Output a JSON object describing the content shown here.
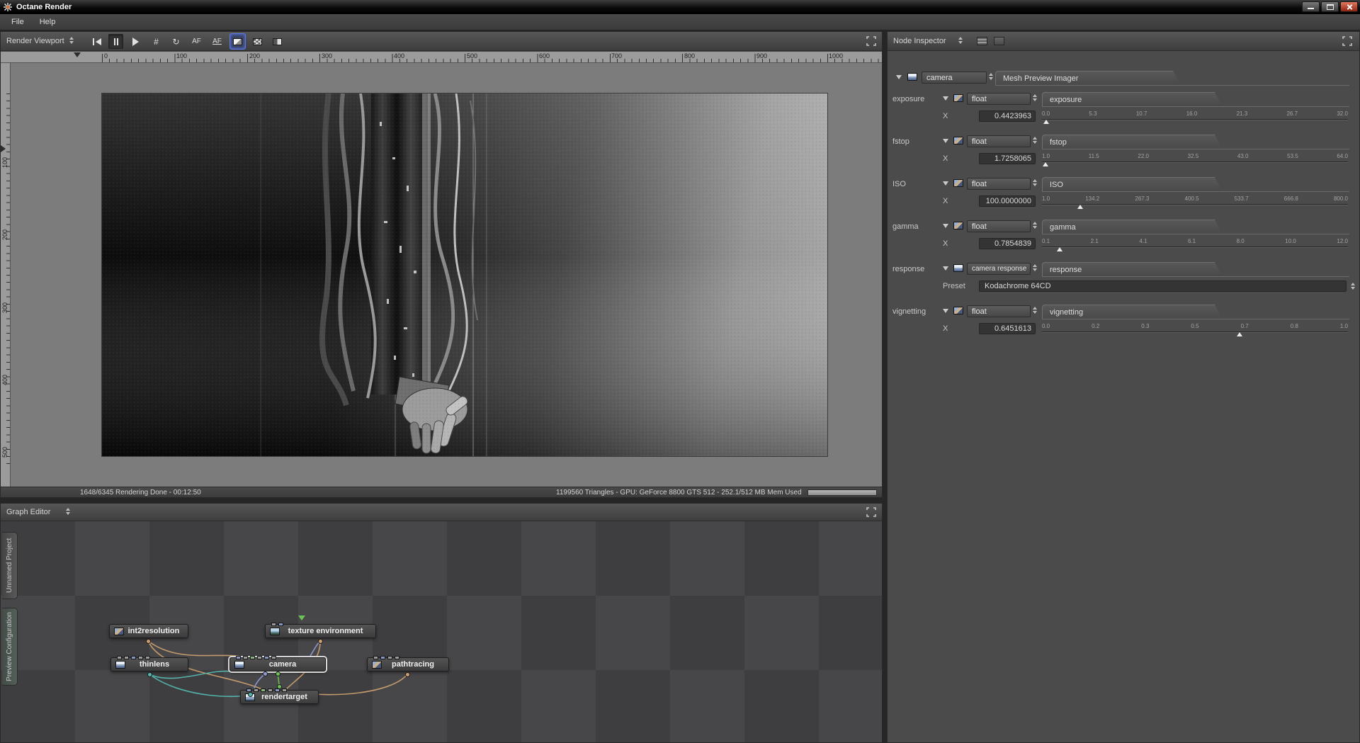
{
  "window": {
    "title": "Octane Render"
  },
  "menubar": {
    "file": "File",
    "help": "Help"
  },
  "render_viewport": {
    "title": "Render Viewport",
    "toolbar": {
      "grid": "#",
      "refresh": "↻",
      "af1": "AF",
      "af2": "AF"
    },
    "ruler_h": [
      "0",
      "100",
      "200",
      "300",
      "400",
      "500",
      "600",
      "700",
      "800",
      "900",
      "1000"
    ],
    "ruler_v": [
      "100",
      "200",
      "300",
      "400",
      "500"
    ],
    "status_left": "1648/6345 Rendering Done - 00:12:50",
    "status_right": "1199560 Triangles - GPU: GeForce 8800 GTS 512 - 252.1/512 MB Mem Used"
  },
  "node_inspector": {
    "title": "Node Inspector",
    "node_selector": "camera",
    "active_tab": "Mesh Preview Imager",
    "params": [
      {
        "group": "exposure",
        "type": "float",
        "tab": "exposure",
        "axis": "X",
        "value": "0.4423963",
        "ticks": [
          "0.0",
          "5.3",
          "10.7",
          "16.0",
          "21.3",
          "26.7",
          "32.0"
        ],
        "marker_pct": 1.4
      },
      {
        "group": "fstop",
        "type": "float",
        "tab": "fstop",
        "axis": "X",
        "value": "1.7258065",
        "ticks": [
          "1.0",
          "11.5",
          "22.0",
          "32.5",
          "43.0",
          "53.5",
          "64.0"
        ],
        "marker_pct": 1.2
      },
      {
        "group": "ISO",
        "type": "float",
        "tab": "ISO",
        "axis": "X",
        "value": "100.0000000",
        "ticks": [
          "1.0",
          "134.2",
          "267.3",
          "400.5",
          "533.7",
          "666.8",
          "800.0"
        ],
        "marker_pct": 12.4
      },
      {
        "group": "gamma",
        "type": "float",
        "tab": "gamma",
        "axis": "X",
        "value": "0.7854839",
        "ticks": [
          "0.1",
          "2.1",
          "4.1",
          "6.1",
          "8.0",
          "10.0",
          "12.0"
        ],
        "marker_pct": 5.8
      },
      {
        "group": "response",
        "type": "camera response",
        "tab": "response",
        "preset_label": "Preset",
        "preset_value": "Kodachrome 64CD"
      },
      {
        "group": "vignetting",
        "type": "float",
        "tab": "vignetting",
        "axis": "X",
        "value": "0.6451613",
        "ticks": [
          "0.0",
          "0.2",
          "0.3",
          "0.5",
          "0.7",
          "0.8",
          "1.0"
        ],
        "marker_pct": 64.5
      }
    ]
  },
  "graph_editor": {
    "title": "Graph Editor",
    "side_tabs": [
      "Unnamed Project",
      "Preview Configuration"
    ],
    "nodes": [
      {
        "label": "int2resolution"
      },
      {
        "label": "texture environment"
      },
      {
        "label": "thinlens"
      },
      {
        "label": "camera"
      },
      {
        "label": "pathtracing"
      },
      {
        "label": "rendertarget"
      }
    ]
  },
  "colors": {
    "wire_tan": "#c99f6e",
    "wire_teal": "#54b8b0",
    "wire_green": "#6cc257",
    "wire_blue": "#8e9bd0",
    "selection_blue": "#5b79e8",
    "pin_blue": "#8696c0",
    "pin_green": "#86b479",
    "pin_gray": "#9a9a9a"
  }
}
